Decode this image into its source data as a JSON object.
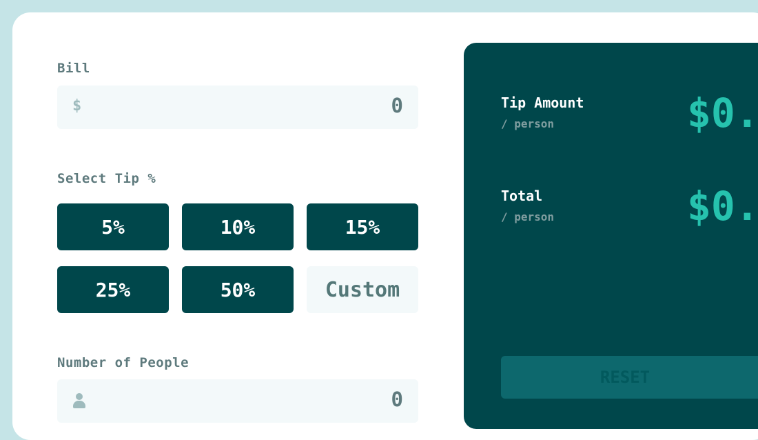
{
  "bill": {
    "label": "Bill",
    "currency_symbol": "$",
    "value": "0"
  },
  "tip": {
    "label": "Select Tip %",
    "options": [
      "5%",
      "10%",
      "15%",
      "25%",
      "50%"
    ],
    "custom_placeholder": "Custom"
  },
  "people": {
    "label": "Number of People",
    "icon": "person-icon",
    "value": "0"
  },
  "results": {
    "tip_amount": {
      "label": "Tip Amount",
      "sub": "/ person",
      "value": "$0."
    },
    "total": {
      "label": "Total",
      "sub": "/ person",
      "value": "$0."
    },
    "reset_label": "RESET"
  },
  "colors": {
    "background": "#c5e4e7",
    "dark_cyan": "#00474b",
    "accent": "#26c2ae",
    "input_bg": "#f3f9fa"
  }
}
